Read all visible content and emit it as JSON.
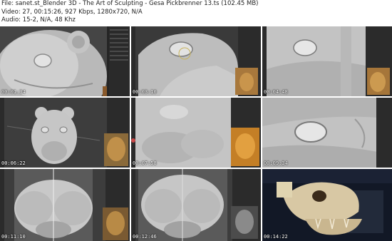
{
  "header": {
    "file_line": "File: sanet.st_Blender 3D - The Art of Sculpting - Gesa Pickbrenner 13.ts (102.45 MB)",
    "video_line": "Video: 27, 00:15:26, 927 Kbps, 1280x720, N/A",
    "audio_line": "Audio: 15-2, N/A, 48 Khz"
  },
  "thumbnails": [
    {
      "timestamp": "00:01:34",
      "scene": "lion-head-sculpt-front-eye"
    },
    {
      "timestamp": "00:03:10",
      "scene": "lion-head-sculpt-eye-closeup"
    },
    {
      "timestamp": "00:04:48",
      "scene": "lion-eye-closeup"
    },
    {
      "timestamp": "00:06:22",
      "scene": "lion-head-front-view"
    },
    {
      "timestamp": "00:07:58",
      "scene": "lion-muzzle-3-4-view"
    },
    {
      "timestamp": "00:09:34",
      "scene": "lion-eye-detail"
    },
    {
      "timestamp": "00:11:10",
      "scene": "lion-muzzle-front"
    },
    {
      "timestamp": "00:12:46",
      "scene": "lion-muzzle-front-2"
    },
    {
      "timestamp": "00:14:22",
      "scene": "lion-skull-photo"
    }
  ],
  "colors": {
    "viewport_bg": "#3c3c3c",
    "sculpt_light": "#d9d9d9",
    "sculpt_mid": "#a8a8a8",
    "sculpt_dark": "#6e6e6e",
    "panel_bg": "#2a2a2a"
  }
}
